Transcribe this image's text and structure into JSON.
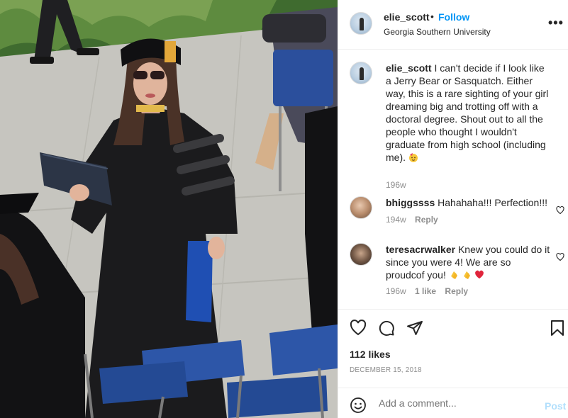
{
  "post": {
    "username": "elie_scott",
    "dot": "•",
    "follow_label": "Follow",
    "location": "Georgia Southern University",
    "more_label": "•••"
  },
  "comments": [
    {
      "username": "elie_scott",
      "text": "I can't decide if I look like a Jerry Bear or Sasquatch. Either way, this is a rare sighting of your girl dreaming big and trotting off with a doctoral degree. Shout out to all the people who thought I wouldn't graduate from high school (including me).",
      "emoji": "party-face-emoji",
      "age": "196w"
    },
    {
      "username": "bhiggssss",
      "text": "Hahahaha!!! Perfection!!!",
      "age": "194w",
      "reply_label": "Reply"
    },
    {
      "username": "teresacrwalker",
      "text": "Knew you could do it since you were 4! We are so proudcof you!",
      "emojis": [
        "clapping-hands-emoji",
        "clapping-hands-emoji",
        "red-heart-emoji"
      ],
      "age": "196w",
      "likes": "1 like",
      "reply_label": "Reply"
    }
  ],
  "actions": {
    "likes": "112 likes",
    "date": "DECEMBER 15, 2018"
  },
  "add_comment": {
    "placeholder": "Add a comment...",
    "post_label": "Post"
  },
  "colors": {
    "accent": "#0095f6",
    "post_disabled": "#b2dffc",
    "secondary_text": "#8e8e8e",
    "heart_red": "#ed4956"
  }
}
